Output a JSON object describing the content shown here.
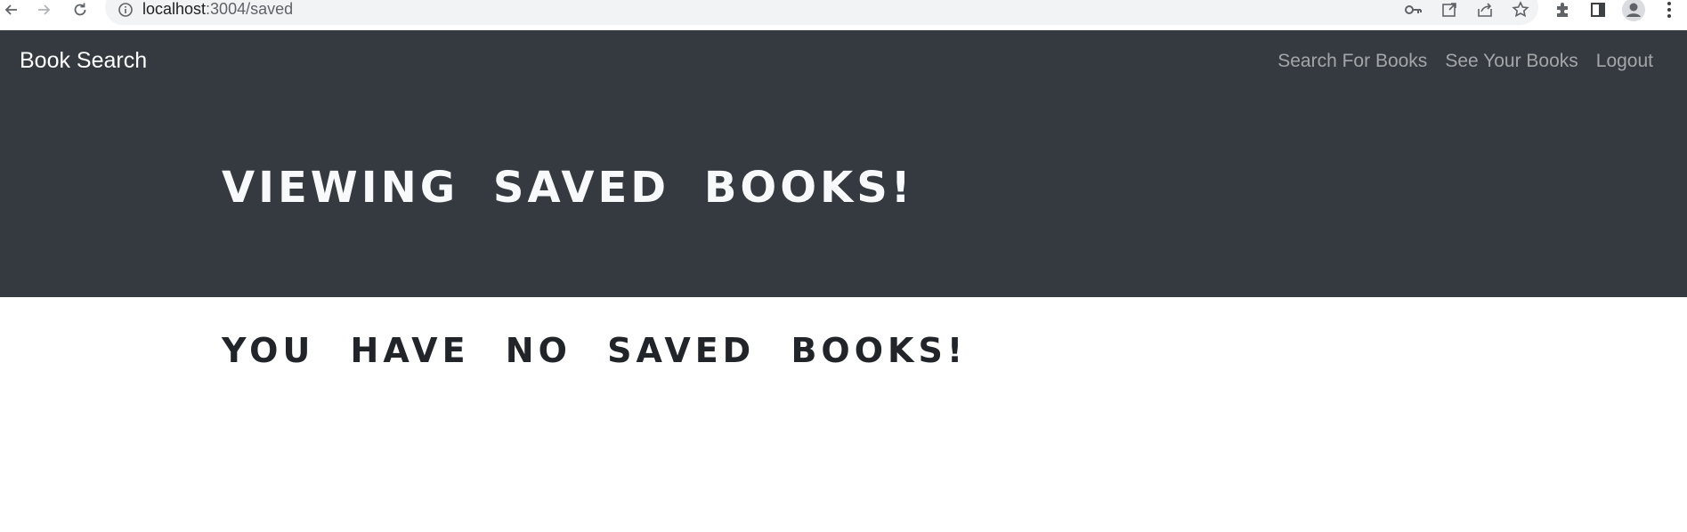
{
  "browser": {
    "url_host": "localhost",
    "url_path": ":3004/saved",
    "icons": {
      "back": "back-arrow-icon",
      "forward": "forward-arrow-icon",
      "reload": "reload-icon",
      "site_info": "info-icon",
      "password": "key-icon",
      "open_in_app": "open-external-icon",
      "share": "share-icon",
      "bookmark": "star-icon",
      "extensions": "puzzle-icon",
      "side_panel": "side-panel-icon",
      "profile": "profile-avatar-icon",
      "menu": "kebab-menu-icon"
    }
  },
  "navbar": {
    "brand": "Book Search",
    "links": [
      {
        "label": "Search For Books"
      },
      {
        "label": "See Your Books"
      },
      {
        "label": "Logout"
      }
    ],
    "background": "#343a40"
  },
  "jumbotron": {
    "title": "VIEWING SAVED BOOKS!"
  },
  "main": {
    "message": "YOU HAVE NO SAVED BOOKS!"
  },
  "colors": {
    "dark": "#343a40",
    "heading_dark": "#212529",
    "heading_light": "#f8f9fa",
    "nav_link": "rgba(255,255,255,0.55)"
  }
}
